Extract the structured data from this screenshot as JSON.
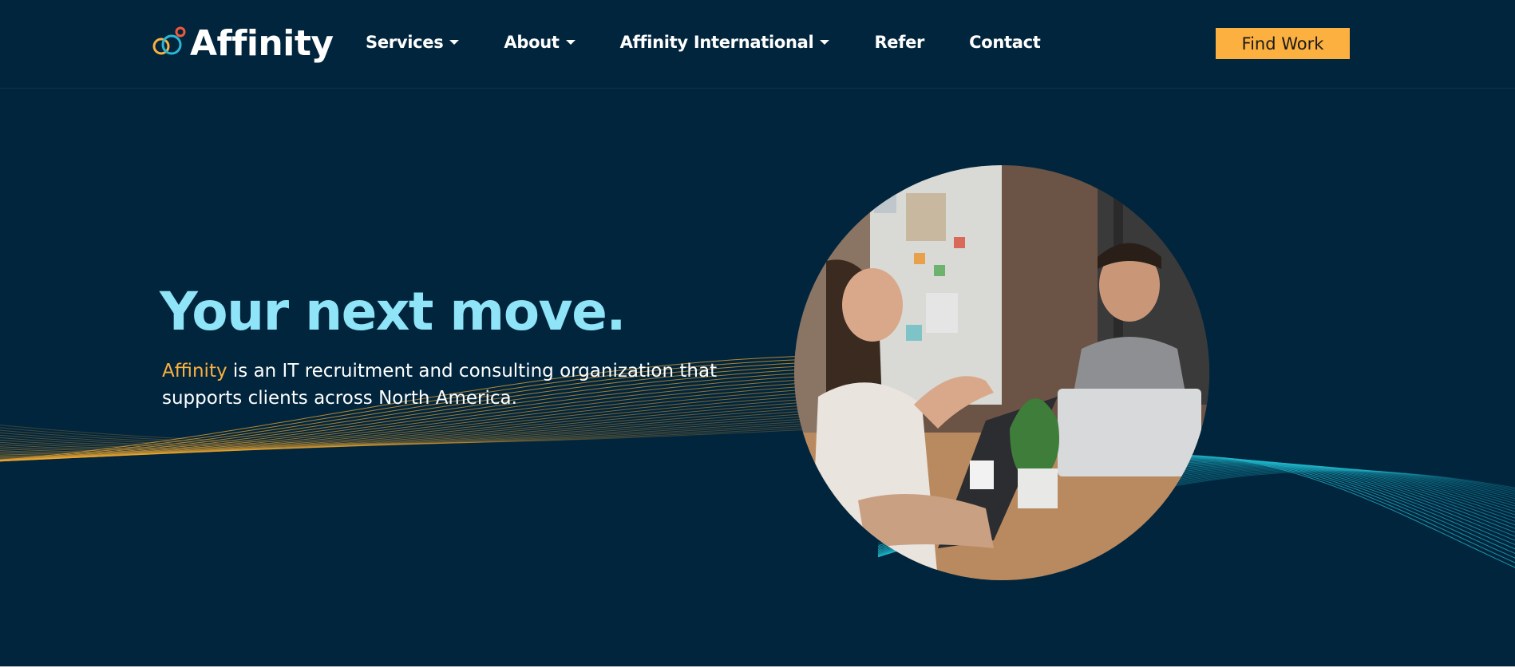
{
  "header": {
    "logo_text": "Affinity",
    "nav": [
      {
        "label": "Services",
        "has_dropdown": true
      },
      {
        "label": "About",
        "has_dropdown": true
      },
      {
        "label": "Affinity International",
        "has_dropdown": true
      },
      {
        "label": "Refer",
        "has_dropdown": false
      },
      {
        "label": "Contact",
        "has_dropdown": false
      }
    ],
    "cta_label": "Find Work"
  },
  "hero": {
    "title": "Your next move.",
    "description_brand": "Affinity",
    "description_rest": " is an IT recruitment and consulting organization that supports clients across North America.",
    "image": "people-meeting-photo"
  },
  "colors": {
    "background": "#01253d",
    "accent": "#fbb040",
    "title": "#8fe4f7",
    "wave_teal": "#1fb5c9",
    "wave_gold": "#f0a830"
  },
  "icons": [
    "affinity-logo-icon",
    "chevron-down-icon"
  ]
}
